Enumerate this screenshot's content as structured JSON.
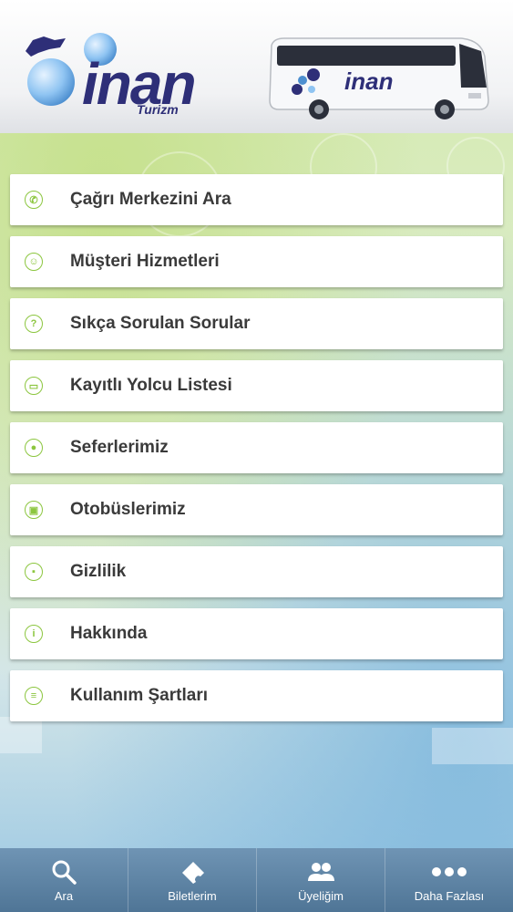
{
  "header": {
    "logo_text": "inan",
    "logo_subtext": "Turizm",
    "bus_brand": "inan"
  },
  "menu": {
    "items": [
      {
        "label": "Çağrı Merkezini Ara",
        "icon": "phone-icon"
      },
      {
        "label": "Müşteri Hizmetleri",
        "icon": "customer-service-icon"
      },
      {
        "label": "Sıkça Sorulan Sorular",
        "icon": "question-icon"
      },
      {
        "label": "Kayıtlı Yolcu Listesi",
        "icon": "passenger-card-icon"
      },
      {
        "label": "Seferlerimiz",
        "icon": "location-pin-icon"
      },
      {
        "label": "Otobüslerimiz",
        "icon": "bus-icon"
      },
      {
        "label": "Gizlilik",
        "icon": "lock-icon"
      },
      {
        "label": "Hakkında",
        "icon": "info-icon"
      },
      {
        "label": "Kullanım Şartları",
        "icon": "list-icon"
      }
    ]
  },
  "tabbar": {
    "tabs": [
      {
        "label": "Ara",
        "icon": "search-icon"
      },
      {
        "label": "Biletlerim",
        "icon": "ticket-icon"
      },
      {
        "label": "Üyeliğim",
        "icon": "users-icon"
      },
      {
        "label": "Daha Fazlası",
        "icon": "more-icon"
      }
    ]
  },
  "colors": {
    "accent": "#8cc63f",
    "brand": "#2e2f78",
    "tabbar": "#5f86a8",
    "text": "#3a3a3a"
  }
}
